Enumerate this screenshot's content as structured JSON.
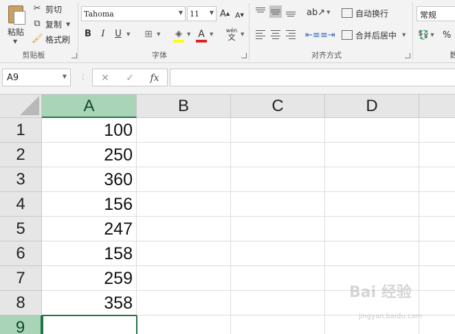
{
  "clipboard": {
    "paste_label": "粘贴",
    "cut_label": "剪切",
    "copy_label": "复制",
    "format_painter_label": "格式刷",
    "group_label": "剪贴板"
  },
  "font": {
    "font_name": "Tahoma",
    "font_size": "11",
    "grow_label": "A",
    "shrink_label": "A",
    "bold": "B",
    "italic": "I",
    "underline": "U",
    "phonetic_label": "wén",
    "phonetic_sub": "文",
    "font_color_letter": "A",
    "group_label": "字体",
    "highlight_color": "#ffff00",
    "font_color": "#e02020"
  },
  "alignment": {
    "wrap_text_label": "自动换行",
    "merge_center_label": "合并后居中",
    "group_label": "对齐方式"
  },
  "number": {
    "format_value": "常规",
    "percent_label": "%",
    "group_label": "数"
  },
  "formula_bar": {
    "name_box": "A9",
    "cancel_symbol": "✕",
    "enter_symbol": "✓",
    "fx_symbol": "fx",
    "formula_value": ""
  },
  "grid": {
    "columns": [
      "A",
      "B",
      "C",
      "D"
    ],
    "rows": [
      "1",
      "2",
      "3",
      "4",
      "5",
      "6",
      "7",
      "8",
      "9"
    ],
    "colA_values": [
      "100",
      "250",
      "360",
      "156",
      "247",
      "158",
      "259",
      "358",
      ""
    ]
  },
  "watermark": {
    "text": "Bai 经验",
    "url": "jingyan.baidu.com"
  },
  "colors": {
    "selected_header": "#a9d4b8",
    "excel_green": "#217346"
  }
}
